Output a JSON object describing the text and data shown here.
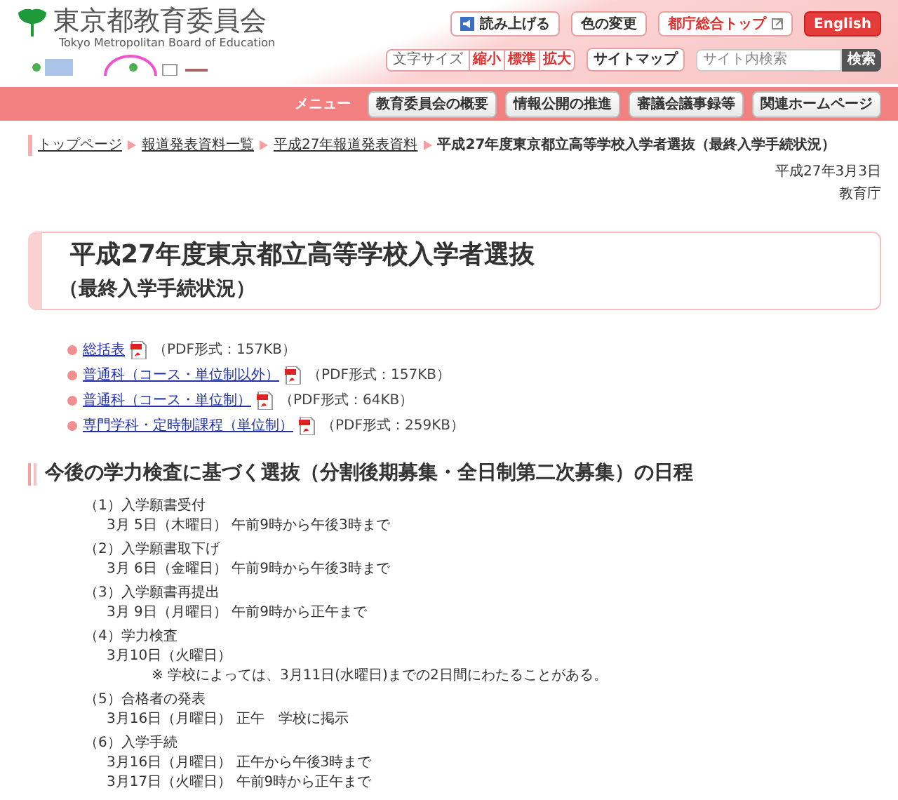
{
  "header": {
    "title": "東京都教育委員会",
    "subtitle": "Tokyo Metropolitan Board of Education",
    "top_buttons": [
      {
        "label": "読み上げる",
        "kind": "speaker"
      },
      {
        "label": "色の変更",
        "kind": "plain"
      },
      {
        "label": "都庁総合トップ",
        "kind": "external"
      },
      {
        "label": "English",
        "kind": "primary"
      }
    ],
    "font_size": {
      "label": "文字サイズ",
      "options": [
        "縮小",
        "標準",
        "拡大"
      ]
    },
    "sitemap": "サイトマップ",
    "search": {
      "placeholder": "サイト内検索",
      "button": "検索"
    }
  },
  "menu": {
    "label": "メニュー",
    "items": [
      "教育委員会の概要",
      "情報公開の推進",
      "審議会議事録等",
      "関連ホームページ"
    ]
  },
  "breadcrumb": [
    {
      "text": "トップページ",
      "kind": "link"
    },
    {
      "text": "報道発表資料一覧",
      "kind": "link"
    },
    {
      "text": "平成27年報道発表資料",
      "kind": "link"
    },
    {
      "text": "平成27年度東京都立高等学校入学者選抜（最終入学手続状況）",
      "kind": "current"
    }
  ],
  "date": "平成27年3月3日",
  "issuer": "教育庁",
  "page_title": {
    "main": "平成27年度東京都立高等学校入学者選抜",
    "sub": "（最終入学手続状況）"
  },
  "documents": [
    {
      "text": "総括表",
      "format": "（PDF形式：157KB）"
    },
    {
      "text": "普通科（コース・単位制以外）",
      "format": "（PDF形式：157KB）"
    },
    {
      "text": "普通科（コース・単位制）",
      "format": "（PDF形式：64KB）"
    },
    {
      "text": "専門学科・定時制課程（単位制）",
      "format": "（PDF形式：259KB）"
    }
  ],
  "section_heading": "今後の学力検査に基づく選抜（分割後期募集・全日制第二次募集）の日程",
  "schedule": [
    {
      "label": "（1）入学願書受付",
      "lines": [
        {
          "kind": "time",
          "text": "3月 5日（木曜日） 午前9時から午後3時まで"
        }
      ]
    },
    {
      "label": "（2）入学願書取下げ",
      "lines": [
        {
          "kind": "time",
          "text": "3月 6日（金曜日） 午前9時から午後3時まで"
        }
      ]
    },
    {
      "label": "（3）入学願書再提出",
      "lines": [
        {
          "kind": "time",
          "text": "3月 9日（月曜日） 午前9時から正午まで"
        }
      ]
    },
    {
      "label": "（4）学力検査",
      "lines": [
        {
          "kind": "time",
          "text": "3月10日（火曜日）"
        },
        {
          "kind": "note",
          "text": "※ 学校によっては、3月11日(水曜日)までの2日間にわたることがある。"
        }
      ]
    },
    {
      "label": "（5）合格者の発表",
      "lines": [
        {
          "kind": "time",
          "text": "3月16日（月曜日） 正午　学校に掲示"
        }
      ]
    },
    {
      "label": "（6）入学手続",
      "lines": [
        {
          "kind": "time",
          "text": "3月16日（月曜日） 正午から午後3時まで"
        },
        {
          "kind": "time",
          "text": "3月17日（火曜日） 午前9時から正午まで"
        }
      ]
    }
  ]
}
